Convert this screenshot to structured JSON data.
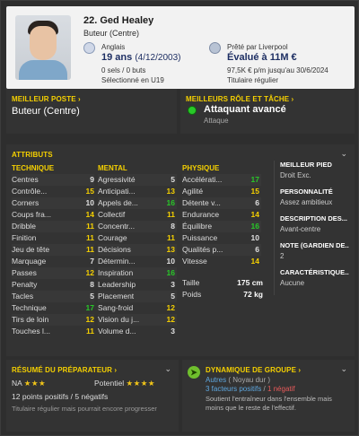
{
  "player": {
    "name": "22. Ged Healey",
    "position": "Buteur (Centre)",
    "nationality": "Anglais",
    "age": "19 ans",
    "dob": "(4/12/2003)",
    "caps": "0 sels / 0 buts",
    "selection": "Sélectionné en U19",
    "loan": "Prêté par Liverpool",
    "value": "Évalué à 11M €",
    "wage": "97,5K € p/m jusqu'au 30/6/2024",
    "status": "Titulaire régulier"
  },
  "best_position": {
    "label": "MEILLEUR POSTE ›",
    "value": "Buteur (Centre)"
  },
  "best_role": {
    "label": "MEILLEURS RÔLE ET TÂCHE ›",
    "role": "Attaquant avancé",
    "duty": "Attaque"
  },
  "attributes": {
    "label": "ATTRIBUTS",
    "technical_title": "TECHNIQUE",
    "mental_title": "MENTAL",
    "physical_title": "PHYSIQUE",
    "technical": [
      {
        "name": "Centres",
        "value": 9
      },
      {
        "name": "Contrôle...",
        "value": 15
      },
      {
        "name": "Corners",
        "value": 10
      },
      {
        "name": "Coups fra...",
        "value": 14
      },
      {
        "name": "Dribble",
        "value": 11
      },
      {
        "name": "Finition",
        "value": 11
      },
      {
        "name": "Jeu de tête",
        "value": 11
      },
      {
        "name": "Marquage",
        "value": 7
      },
      {
        "name": "Passes",
        "value": 12
      },
      {
        "name": "Penalty",
        "value": 8
      },
      {
        "name": "Tacles",
        "value": 5
      },
      {
        "name": "Technique",
        "value": 17
      },
      {
        "name": "Tirs de loin",
        "value": 12
      },
      {
        "name": "Touches l...",
        "value": 11
      }
    ],
    "mental": [
      {
        "name": "Agressivité",
        "value": 5
      },
      {
        "name": "Anticipati...",
        "value": 13
      },
      {
        "name": "Appels de...",
        "value": 16
      },
      {
        "name": "Collectif",
        "value": 11
      },
      {
        "name": "Concentr...",
        "value": 8
      },
      {
        "name": "Courage",
        "value": 11
      },
      {
        "name": "Décisions",
        "value": 13
      },
      {
        "name": "Détermin...",
        "value": 10
      },
      {
        "name": "Inspiration",
        "value": 16
      },
      {
        "name": "Leadership",
        "value": 3
      },
      {
        "name": "Placement",
        "value": 5
      },
      {
        "name": "Sang-froid",
        "value": 12
      },
      {
        "name": "Vision du j...",
        "value": 12
      },
      {
        "name": "Volume d...",
        "value": 3
      }
    ],
    "physical": [
      {
        "name": "Accélérati...",
        "value": 17
      },
      {
        "name": "Agilité",
        "value": 15
      },
      {
        "name": "Détente v...",
        "value": 6
      },
      {
        "name": "Endurance",
        "value": 14
      },
      {
        "name": "Équilibre",
        "value": 16
      },
      {
        "name": "Puissance",
        "value": 10
      },
      {
        "name": "Qualités p...",
        "value": 6
      },
      {
        "name": "Vitesse",
        "value": 14
      }
    ],
    "height_label": "Taille",
    "height": "175 cm",
    "weight_label": "Poids",
    "weight": "72 kg"
  },
  "side": {
    "foot_title": "MEILLEUR PIED",
    "foot_value": "Droit Exc.",
    "pers_title": "PERSONNALITÉ",
    "pers_value": "Assez ambitieux",
    "desc_title": "DESCRIPTION DES...",
    "desc_value": "Avant-centre",
    "gk_title": "NOTE (GARDIEN DE...",
    "gk_value": "2",
    "chars_title": "CARACTÉRISTIQUE...",
    "chars_value": "Aucune"
  },
  "report": {
    "label": "RÉSUMÉ DU PRÉPARATEUR ›",
    "ability_label": "NA",
    "ability_stars": "★★★",
    "potential_label": "Potentiel",
    "potential_stars": "★★★★",
    "points": "12 points positifs / 5 négatifs",
    "summary": "Titulaire régulier mais pourrait encore progresser"
  },
  "dynamics": {
    "label": "DYNAMIQUE DE GROUPE ›",
    "group": "Autres",
    "core": "( Noyau dur )",
    "positives": "3 facteurs positifs",
    "negatives": "1 négatif",
    "description": "Soutient l'entraîneur dans l'ensemble mais moins que le reste de l'effectif."
  },
  "colors": {
    "accent": "#f5d000",
    "good": "#28c828",
    "mid": "#f5d000",
    "low": "#e0e0e0"
  }
}
